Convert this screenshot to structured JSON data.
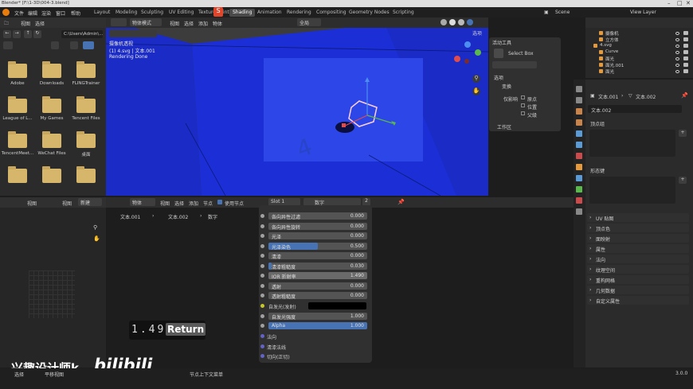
{
  "window_title": "Blender* [F:\\1-3D\\004-3.blend]",
  "menu": [
    "文件",
    "编辑",
    "渲染",
    "窗口",
    "帮助"
  ],
  "workspaces": [
    "Layout",
    "Modeling",
    "Sculpting",
    "UV Editing",
    "Texture Paint",
    "Shading",
    "Animation",
    "Rendering",
    "Compositing",
    "Geometry Nodes",
    "Scripting"
  ],
  "active_workspace": "Shading",
  "scene": "Scene",
  "view_layer": "View Layer",
  "file_browser": {
    "menu": [
      "视图",
      "选择"
    ],
    "path": "C:\\Users\\Admin\\...",
    "folders": [
      "Adobe",
      "Downloads",
      "FLINGTrainer",
      "League of L...",
      "My Games",
      "Tencent Files",
      "TencentMeet...",
      "WeChat Files",
      "桌面",
      "",
      "",
      ""
    ]
  },
  "viewport": {
    "mode": "物体模式",
    "menu": [
      "视图",
      "选择",
      "添加",
      "物体"
    ],
    "transform": "全局",
    "camera_label": "摄像机透视",
    "object_label": "(1) 4.svg | 文本.001",
    "status": "Rendering Done",
    "options": "选项"
  },
  "tool_panel": {
    "title": "活动工具",
    "tool": "Select Box",
    "options_title": "选项",
    "transform": "变换",
    "affect_only": "仅影响",
    "origins": "原点",
    "locations": "位置",
    "parents": "父级",
    "workspace": "工作区"
  },
  "image_editor": {
    "menu": [
      "视图",
      "视图"
    ],
    "new": "新建"
  },
  "node_editor": {
    "type": "物体",
    "menu": [
      "视图",
      "选择",
      "添加",
      "节点"
    ],
    "use_nodes": "使用节点",
    "slot": "Slot 1",
    "material": "数字",
    "user_count": "2",
    "breadcrumb": [
      "文本.001",
      "文本.002",
      "数字"
    ]
  },
  "bsdf_props": [
    {
      "label": "各向异性过滤",
      "value": "0.000",
      "fill": 0
    },
    {
      "label": "各向异性旋转",
      "value": "0.000",
      "fill": 0
    },
    {
      "label": "光泽",
      "value": "0.000",
      "fill": 0
    },
    {
      "label": "光泽染色",
      "value": "0.500",
      "fill": 0.5
    },
    {
      "label": "清漆",
      "value": "0.000",
      "fill": 0
    },
    {
      "label": "清漆粗糙度",
      "value": "0.030",
      "fill": 0.03
    },
    {
      "label": "IOR 折射率",
      "value": "1.490",
      "fill": 0
    },
    {
      "label": "透射",
      "value": "0.000",
      "fill": 0
    },
    {
      "label": "透射粗糙度",
      "value": "0.000",
      "fill": 0
    }
  ],
  "emission_label": "自发光(发射)",
  "emission_strength": {
    "label": "自发光强度",
    "value": "1.000"
  },
  "alpha": {
    "label": "Alpha",
    "value": "1.000"
  },
  "normal_label": "法向",
  "clearcoat_normal_label": "清漆法线",
  "tangent_label": "切向(正切)",
  "overlay": {
    "key_hint": "1.49",
    "key_name": "Return",
    "watermark": "兴趣设计师k",
    "brand": "bilibili"
  },
  "outliner": {
    "items": [
      {
        "name": "摄像机",
        "indent": 2
      },
      {
        "name": "立方体",
        "indent": 2
      },
      {
        "name": "4.svg",
        "indent": 1
      },
      {
        "name": "Curve",
        "indent": 2
      },
      {
        "name": "面光",
        "indent": 2
      },
      {
        "name": "面光.001",
        "indent": 2
      },
      {
        "name": "面光",
        "indent": 2
      }
    ]
  },
  "properties": {
    "object": "文本.001",
    "data": "文本.002",
    "data_name": "文本.002",
    "vertex_groups": "顶点组",
    "shape_keys": "形态键",
    "sections": [
      "UV 贴图",
      "顶点色",
      "面映射",
      "属性",
      "法向",
      "纹理空间",
      "重构网格",
      "几何数据",
      "自定义属性"
    ]
  },
  "status_bar": {
    "select": "选择",
    "pan": "平移视图",
    "context_menu": "节点上下文菜单",
    "version": "3.0.0"
  },
  "colors": {
    "accent_blue": "#4772b3",
    "scene_blue": "#1c2fd6",
    "folder": "#d5b66a"
  }
}
